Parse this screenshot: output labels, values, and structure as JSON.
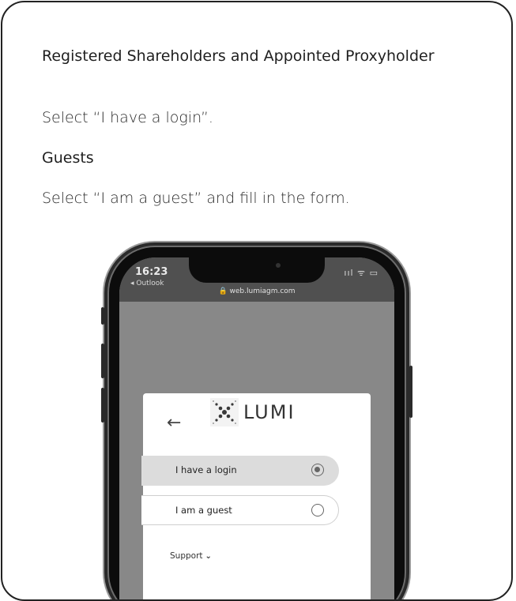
{
  "instructions": {
    "heading1": "Registered Shareholders and Appointed Proxyholder",
    "step1": "Select “I have a login”.",
    "heading2": "Guests",
    "step2": "Select “I am a guest” and fill in the form."
  },
  "phone": {
    "time": "16:23",
    "back_app": "◂ Outlook",
    "status_icons": "ııl ᯤ ▭",
    "url": "🔒 web.lumiagm.com",
    "login_card": {
      "back_arrow": "←",
      "logo_text": "LUMI",
      "options": [
        {
          "label": "I have a login",
          "selected": true
        },
        {
          "label": "I am a guest",
          "selected": false
        }
      ],
      "support_label": "Support",
      "support_chevron": "⌄"
    }
  },
  "colors": {
    "screen_bg": "#888888",
    "statusbar_bg": "#505050",
    "selected_option_bg": "#dcdcdc"
  }
}
